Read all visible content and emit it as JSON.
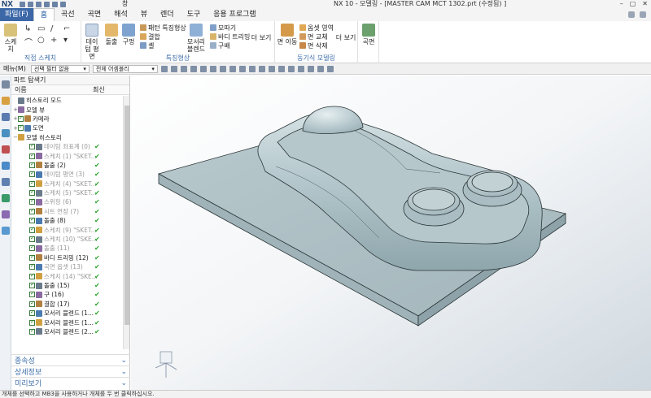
{
  "titlebar": {
    "app": "NX",
    "title": "NX 10 - 모델링 - [MASTER CAM MCT 1302.prt (수정됨) ]",
    "window_label": "창"
  },
  "ribbon_tabs": [
    "파일(F)",
    "홈",
    "곡선",
    "곡면",
    "해석",
    "뷰",
    "렌더",
    "도구",
    "응용 프로그램"
  ],
  "ribbon": {
    "sketch_label": "스케치",
    "direct_sketch_group": "직접 스케치",
    "datum_plane_label": "데이텀 평면",
    "extrude_label": "돌출",
    "sphere_label": "구멍",
    "pattern_feature": "패턴 특징형상",
    "combine": "결합",
    "shell": "셸",
    "edge_blend": "모서리 블렌드",
    "chamfer": "모따기",
    "trim_body": "바디 트리밍",
    "draft": "구배",
    "more1": "더 보기",
    "feature_group": "특징형상",
    "move_face": "면 이동",
    "offset_region": "옵셋 영역",
    "replace_face": "면 교체",
    "delete_face": "면 삭제",
    "more2": "더 보기",
    "sync_group": "동기식 모델링",
    "surface_label": "곡면"
  },
  "toolbar": {
    "menu": "메뉴(M)",
    "filter": "선택 필터 없음",
    "scope": "전체 어셈블리"
  },
  "navigator": {
    "title": "파트 탐색기",
    "col_name": "이름",
    "col_latest": "최신",
    "rows": [
      {
        "label": "히스토리 모드",
        "indent": 0,
        "expand": "",
        "check": false,
        "dim": false,
        "latest": ""
      },
      {
        "label": "모델 뷰",
        "indent": 0,
        "expand": "+",
        "check": false,
        "dim": false,
        "latest": ""
      },
      {
        "label": "카메라",
        "indent": 0,
        "expand": "+",
        "check": true,
        "dim": false,
        "latest": ""
      },
      {
        "label": "도면",
        "indent": 0,
        "expand": "+",
        "check": true,
        "dim": false,
        "latest": ""
      },
      {
        "label": "모델 히스토리",
        "indent": 0,
        "expand": "−",
        "check": false,
        "dim": false,
        "latest": ""
      },
      {
        "label": "데이텀 좌표계 (0)",
        "indent": 1,
        "expand": "",
        "check": true,
        "dim": true,
        "latest": "✔"
      },
      {
        "label": "스케치 (1) \"SKET...",
        "indent": 1,
        "expand": "",
        "check": true,
        "dim": true,
        "latest": "✔"
      },
      {
        "label": "돌출 (2)",
        "indent": 1,
        "expand": "",
        "check": true,
        "dim": false,
        "latest": "✔"
      },
      {
        "label": "데이텀 평면 (3)",
        "indent": 1,
        "expand": "",
        "check": true,
        "dim": true,
        "latest": "✔"
      },
      {
        "label": "스케치 (4) \"SKET...",
        "indent": 1,
        "expand": "",
        "check": true,
        "dim": true,
        "latest": "✔"
      },
      {
        "label": "스케치 (5) \"SKET...",
        "indent": 1,
        "expand": "",
        "check": true,
        "dim": true,
        "latest": "✔"
      },
      {
        "label": "스위핑 (6)",
        "indent": 1,
        "expand": "",
        "check": true,
        "dim": true,
        "latest": "✔"
      },
      {
        "label": "시트 연장 (7)",
        "indent": 1,
        "expand": "",
        "check": true,
        "dim": true,
        "latest": "✔"
      },
      {
        "label": "돌출 (8)",
        "indent": 1,
        "expand": "",
        "check": true,
        "dim": false,
        "latest": "✔"
      },
      {
        "label": "스케치 (9) \"SKET...",
        "indent": 1,
        "expand": "",
        "check": true,
        "dim": true,
        "latest": "✔"
      },
      {
        "label": "스케치 (10) \"SKE...",
        "indent": 1,
        "expand": "",
        "check": true,
        "dim": true,
        "latest": "✔"
      },
      {
        "label": "돌출 (11)",
        "indent": 1,
        "expand": "",
        "check": true,
        "dim": true,
        "latest": "✔"
      },
      {
        "label": "바디 트리밍 (12)",
        "indent": 1,
        "expand": "",
        "check": true,
        "dim": false,
        "latest": "✔"
      },
      {
        "label": "곡면 옵셋 (13)",
        "indent": 1,
        "expand": "",
        "check": true,
        "dim": true,
        "latest": "✔"
      },
      {
        "label": "스케치 (14) \"SKE...",
        "indent": 1,
        "expand": "",
        "check": true,
        "dim": true,
        "latest": "✔"
      },
      {
        "label": "돌출 (15)",
        "indent": 1,
        "expand": "",
        "check": true,
        "dim": false,
        "latest": "✔"
      },
      {
        "label": "구 (16)",
        "indent": 1,
        "expand": "",
        "check": true,
        "dim": false,
        "latest": "✔"
      },
      {
        "label": "결합 (17)",
        "indent": 1,
        "expand": "",
        "check": true,
        "dim": false,
        "latest": "✔"
      },
      {
        "label": "모서리 블렌드 (1...",
        "indent": 1,
        "expand": "",
        "check": true,
        "dim": false,
        "latest": "✔"
      },
      {
        "label": "모서리 블렌드 (1...",
        "indent": 1,
        "expand": "",
        "check": true,
        "dim": false,
        "latest": "✔"
      },
      {
        "label": "모서리 블렌드 (2...",
        "indent": 1,
        "expand": "",
        "check": true,
        "dim": false,
        "latest": "✔"
      }
    ],
    "panels": [
      "종속성",
      "상세정보",
      "미리보기"
    ]
  },
  "status": "개체를 선택하고 MB3을 사용하거나 개체를 두 번 클릭하십시오.",
  "colors": {
    "model_face": "#a9bcc0",
    "model_edge": "#2a3436",
    "accent": "#3c68a8"
  }
}
